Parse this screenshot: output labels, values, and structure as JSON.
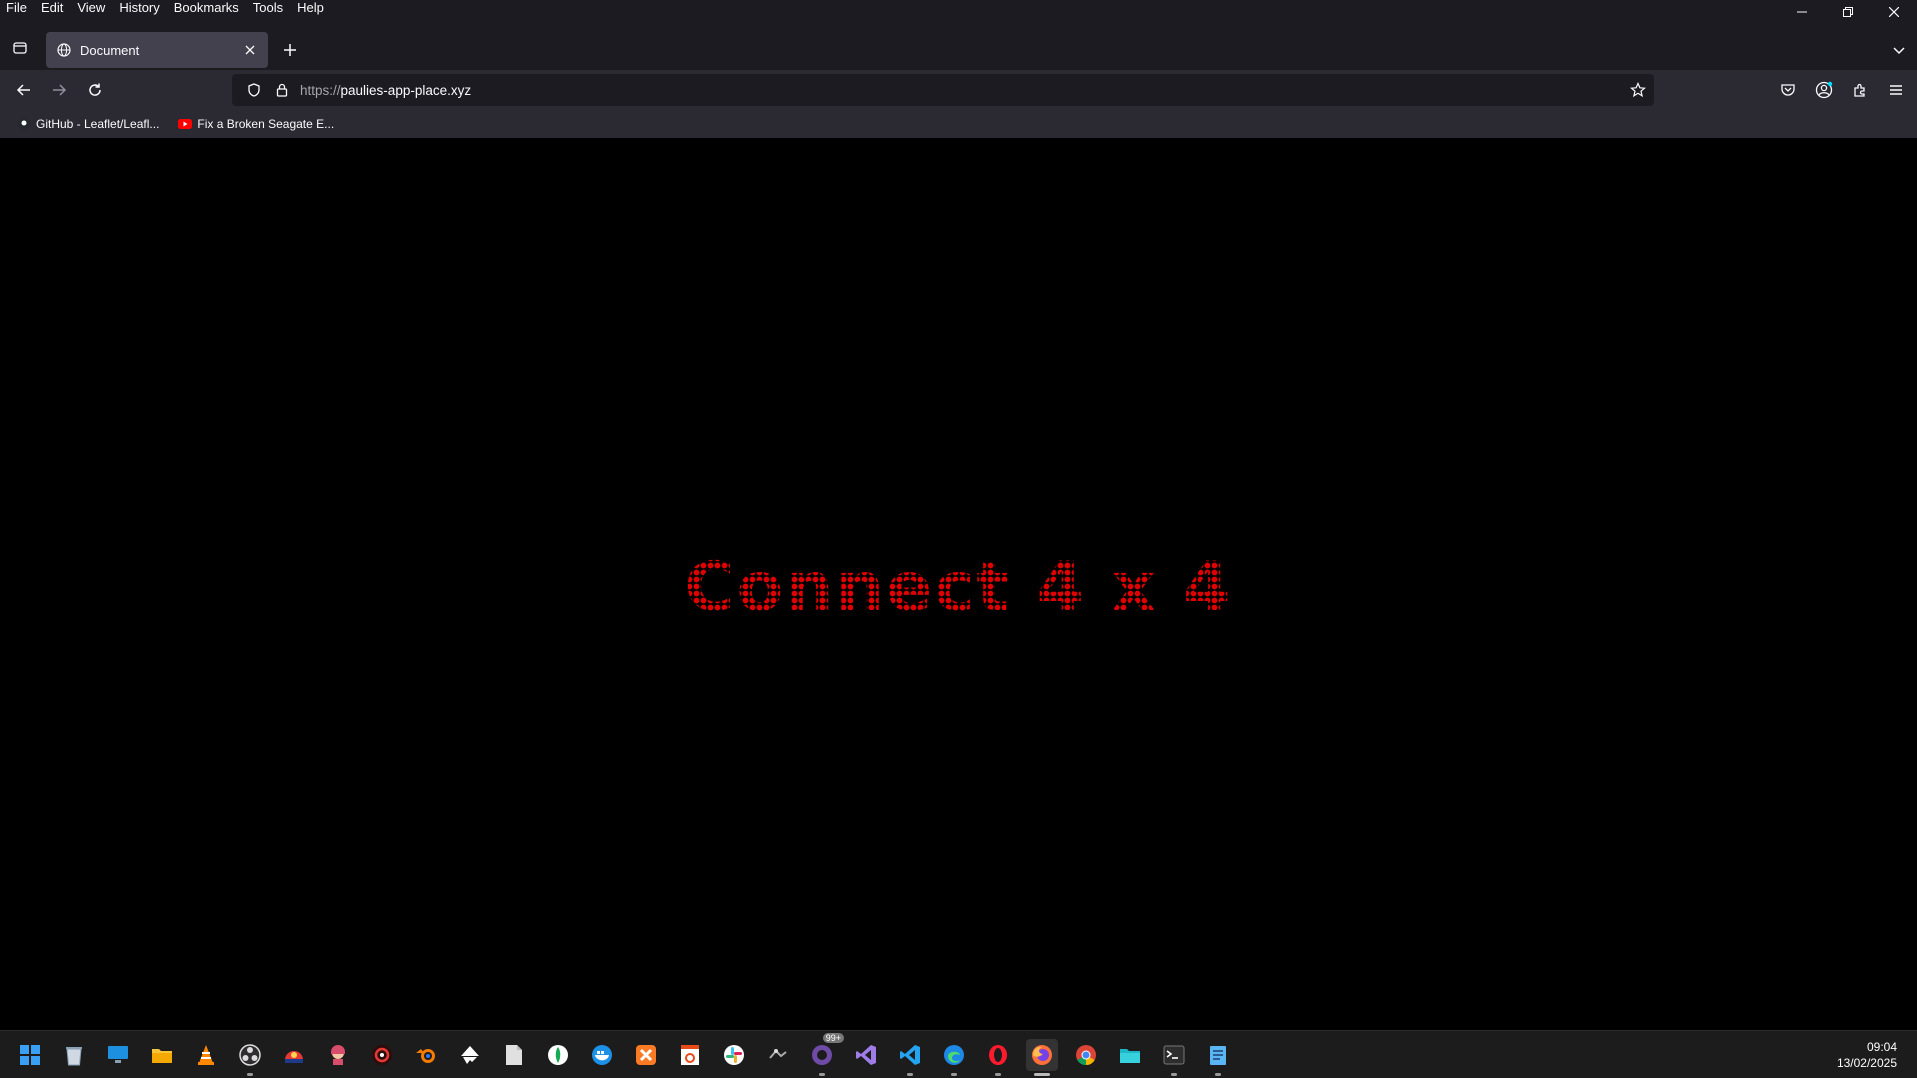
{
  "menubar": {
    "items": [
      "File",
      "Edit",
      "View",
      "History",
      "Bookmarks",
      "Tools",
      "Help"
    ]
  },
  "window_controls": {
    "minimize_icon": "minimize-icon",
    "restore_icon": "restore-icon",
    "close_icon": "close-icon"
  },
  "tabs": [
    {
      "title": "Document",
      "active": true,
      "icon": "globe-icon"
    }
  ],
  "navbar": {
    "url_scheme": "https://",
    "url_host": "paulies-app-place.xyz"
  },
  "bookmarks": [
    {
      "label": "GitHub - Leaflet/Leafl...",
      "icon": "github-icon"
    },
    {
      "label": "Fix a Broken Seagate E...",
      "icon": "youtube-icon"
    }
  ],
  "page": {
    "headline": "Connect 4 x 4",
    "headline_color": "#e00000",
    "background": "#000000"
  },
  "taskbar": {
    "icons": [
      "windows-start-icon",
      "recycle-bin-icon",
      "desktop-icon",
      "file-explorer-icon",
      "vlc-icon",
      "obs-icon",
      "app-icon",
      "app-icon",
      "app-icon",
      "blender-icon",
      "inkscape-icon",
      "file-icon",
      "mongodb-icon",
      "docker-icon",
      "xampp-icon",
      "app-icon",
      "slack-icon",
      "app-icon",
      "github-desktop-icon",
      "visual-studio-icon",
      "vscode-icon",
      "edge-icon",
      "opera-icon",
      "firefox-icon",
      "chrome-icon",
      "folder-icon",
      "terminal-icon",
      "notepad-icon"
    ],
    "badge": "99+",
    "time": "09:04",
    "date": "13/02/2025"
  }
}
